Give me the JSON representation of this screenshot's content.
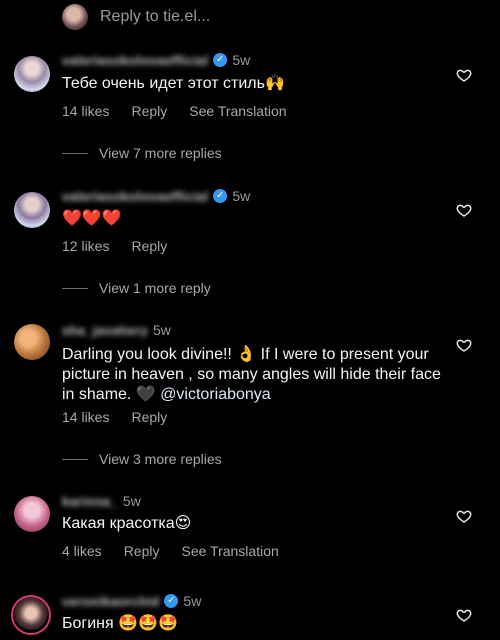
{
  "reply_bar": {
    "label": "Reply to tie.el..."
  },
  "comments": [
    {
      "username": "valeriasokolovaofficial",
      "verified": true,
      "time": "5w",
      "text": "Тебе очень идет этот стиль🙌",
      "likes": "14 likes",
      "reply": "Reply",
      "translation": "See Translation",
      "view_replies": "View 7 more replies"
    },
    {
      "username": "valeriasokolovaofficial",
      "verified": true,
      "time": "5w",
      "text": "❤️❤️❤️",
      "likes": "12 likes",
      "reply": "Reply",
      "view_replies": "View 1 more reply"
    },
    {
      "username": "sha_javahery",
      "verified": false,
      "time": "5w",
      "text_before": "Darling you look divine!! 👌 If I were to present your picture in heaven , so many angles will hide their face in shame. 🖤 ",
      "mention": "@victoriabonya",
      "likes": "14 likes",
      "reply": "Reply",
      "view_replies": "View 3 more replies"
    },
    {
      "username": "karinna_",
      "verified": false,
      "time": "5w",
      "text": "Какая красотка😍",
      "likes": "4 likes",
      "reply": "Reply",
      "translation": "See Translation"
    },
    {
      "username": "veronikaorchid",
      "verified": true,
      "time": "5w",
      "text": "Богиня 🤩🤩🤩"
    }
  ],
  "icons": {
    "heart": "heart-outline-icon",
    "verified": "verified-badge-icon"
  },
  "colors": {
    "background": "#000000",
    "verified": "#3897f0",
    "secondary_text": "#a8a8a8"
  }
}
